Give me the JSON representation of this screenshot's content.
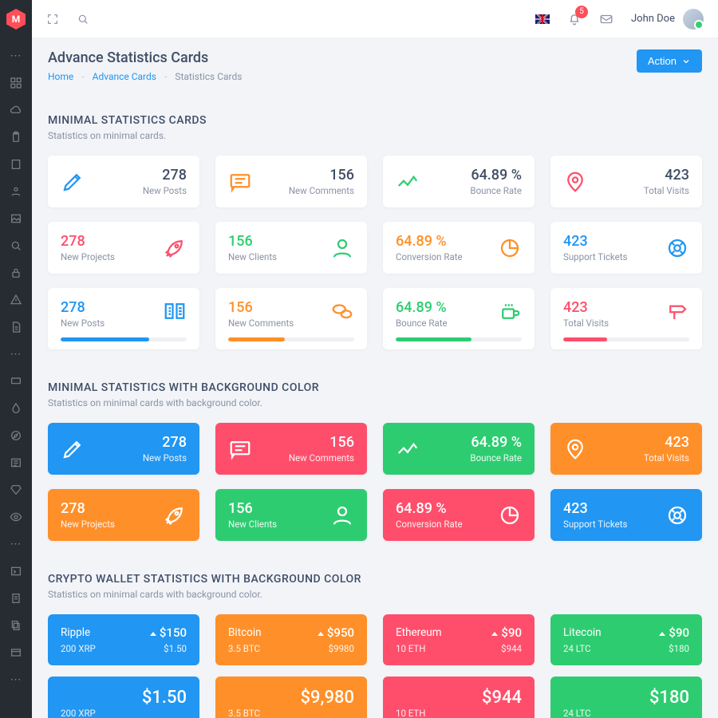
{
  "brand_letter": "M",
  "header": {
    "notification_count": "5",
    "user_name": "John Doe"
  },
  "page": {
    "title": "Advance Statistics Cards",
    "breadcrumb": [
      "Home",
      "Advance Cards",
      "Statistics Cards"
    ],
    "action_label": "Action"
  },
  "sections": {
    "minimal": {
      "title": "MINIMAL STATISTICS CARDS",
      "subtitle": "Statistics on minimal cards."
    },
    "minimal_bg": {
      "title": "MINIMAL STATISTICS WITH BACKGROUND COLOR",
      "subtitle": "Statistics on minimal cards with background color."
    },
    "crypto": {
      "title": "CRYPTO WALLET STATISTICS WITH BACKGROUND COLOR",
      "subtitle": "Statistics on minimal cards with background color."
    }
  },
  "row1": [
    {
      "value": "278",
      "label": "New Posts"
    },
    {
      "value": "156",
      "label": "New Comments"
    },
    {
      "value": "64.89 %",
      "label": "Bounce Rate"
    },
    {
      "value": "423",
      "label": "Total Visits"
    }
  ],
  "row2": [
    {
      "value": "278",
      "label": "New Projects"
    },
    {
      "value": "156",
      "label": "New Clients"
    },
    {
      "value": "64.89 %",
      "label": "Conversion Rate"
    },
    {
      "value": "423",
      "label": "Support Tickets"
    }
  ],
  "row3": [
    {
      "value": "278",
      "label": "New Posts",
      "progress": 70
    },
    {
      "value": "156",
      "label": "New Comments",
      "progress": 45
    },
    {
      "value": "64.89 %",
      "label": "Bounce Rate",
      "progress": 60
    },
    {
      "value": "423",
      "label": "Total Visits",
      "progress": 35
    }
  ],
  "crypto_row": [
    {
      "name": "Ripple",
      "price": "$150",
      "holdings": "200 XRP",
      "value2": "$1.50"
    },
    {
      "name": "Bitcoin",
      "price": "$950",
      "holdings": "3.5 BTC",
      "value2": "$9980"
    },
    {
      "name": "Ethereum",
      "price": "$90",
      "holdings": "10 ETH",
      "value2": "$944"
    },
    {
      "name": "Litecoin",
      "price": "$90",
      "holdings": "24 LTC",
      "value2": "$180"
    }
  ],
  "crypto_big": [
    {
      "big": "$1.50",
      "sub_left": "200 XRP"
    },
    {
      "big": "$9,980",
      "sub_left": "3.5 BTC"
    },
    {
      "big": "$944",
      "sub_left": "10 ETH"
    },
    {
      "big": "$180",
      "sub_left": "24 LTC"
    }
  ],
  "colors": {
    "blue": "#2196f3",
    "orange": "#ff8f29",
    "green": "#2ecc71",
    "pink": "#ff4e6b"
  }
}
